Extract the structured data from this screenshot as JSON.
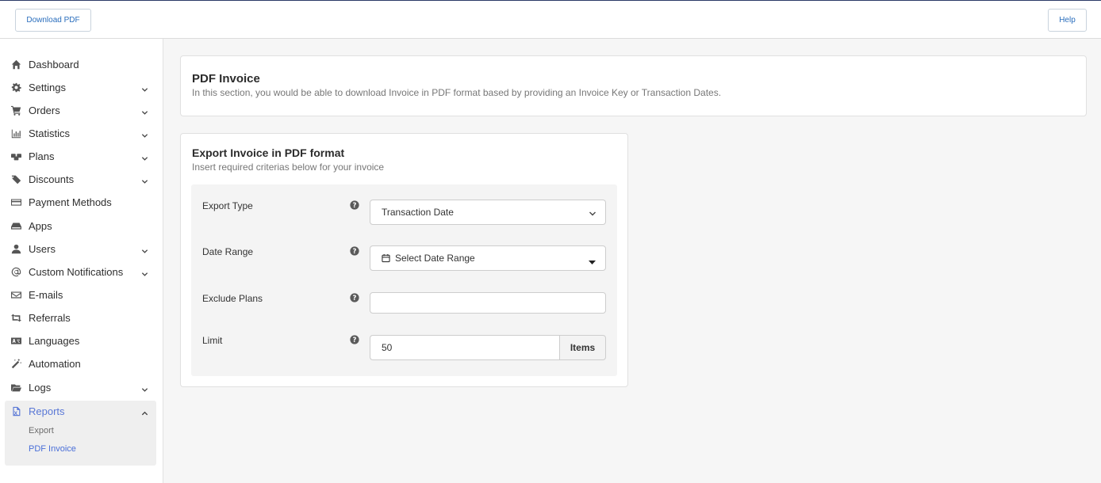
{
  "header": {
    "download_label": "Download PDF",
    "help_label": "Help"
  },
  "sidebar": {
    "items": [
      {
        "label": "Dashboard",
        "icon": "home-icon",
        "expandable": false
      },
      {
        "label": "Settings",
        "icon": "gear-icon",
        "expandable": true
      },
      {
        "label": "Orders",
        "icon": "cart-icon",
        "expandable": true
      },
      {
        "label": "Statistics",
        "icon": "bar-chart-icon",
        "expandable": true
      },
      {
        "label": "Plans",
        "icon": "boxes-icon",
        "expandable": true
      },
      {
        "label": "Discounts",
        "icon": "tags-icon",
        "expandable": true
      },
      {
        "label": "Payment Methods",
        "icon": "credit-card-icon",
        "expandable": false
      },
      {
        "label": "Apps",
        "icon": "server-icon",
        "expandable": false
      },
      {
        "label": "Users",
        "icon": "user-icon",
        "expandable": true
      },
      {
        "label": "Custom Notifications",
        "icon": "at-icon",
        "expandable": true
      },
      {
        "label": "E-mails",
        "icon": "envelope-icon",
        "expandable": false
      },
      {
        "label": "Referrals",
        "icon": "retweet-icon",
        "expandable": false
      },
      {
        "label": "Languages",
        "icon": "language-icon",
        "expandable": false
      },
      {
        "label": "Automation",
        "icon": "magic-wand-icon",
        "expandable": false
      },
      {
        "label": "Logs",
        "icon": "folder-open-icon",
        "expandable": true
      }
    ],
    "reports": {
      "label": "Reports",
      "icon": "file-report-icon",
      "subitems": [
        "Export",
        "PDF Invoice"
      ],
      "active_subitem": "PDF Invoice"
    }
  },
  "intro": {
    "title": "PDF Invoice",
    "description": "In this section, you would be able to download Invoice in PDF format based by providing an Invoice Key or Transaction Dates."
  },
  "export_card": {
    "title": "Export Invoice in PDF format",
    "subtitle": "Insert required criterias below for your invoice",
    "fields": {
      "export_type": {
        "label": "Export Type",
        "value": "Transaction Date"
      },
      "date_range": {
        "label": "Date Range",
        "value": "Select Date Range"
      },
      "exclude_plans": {
        "label": "Exclude Plans",
        "value": ""
      },
      "limit": {
        "label": "Limit",
        "value": "50",
        "addon": "Items"
      }
    }
  },
  "colors": {
    "accent": "#5a78d6",
    "link": "#2a6ebd",
    "background": "#f6f6f6"
  }
}
